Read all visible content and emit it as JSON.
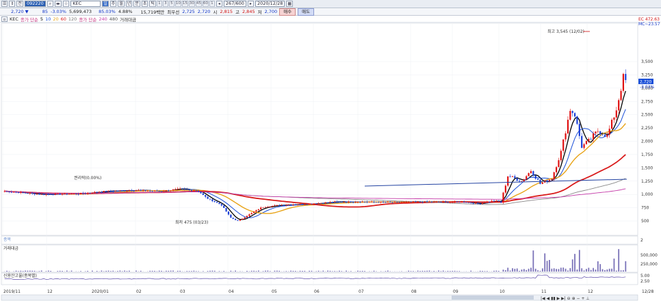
{
  "toolbar": {
    "code": "092220",
    "name": "KEC",
    "count": "267/600",
    "date": "2020/12/28",
    "periods": [
      "1",
      "3",
      "5",
      "10",
      "15",
      "30",
      "45",
      "60",
      "1"
    ],
    "daily_labels": [
      "주",
      "월",
      "년",
      "분",
      "초",
      "틱"
    ]
  },
  "quote": {
    "price": "2,720 ▼",
    "change": "85",
    "change_pct": "-3.03%",
    "volume": "5,699,473",
    "vol_ratio": "85.03%",
    "turnover": "4.88%",
    "amount": "15,719백만",
    "label_open": "최우선",
    "open": "2,725",
    "open2": "2,720",
    "label_high": "시",
    "high": "2,815",
    "label_hi": "고",
    "hi": "2,845",
    "label_lo": "저",
    "lo": "2,700",
    "buy": "매수",
    "sell": "매도"
  },
  "legend": {
    "name": "KEC",
    "ma_label": "종가 단순",
    "ma": [
      "5",
      "10",
      "20",
      "60",
      "120"
    ],
    "ma2_label": "종가 단순",
    "ma2": [
      "240",
      "480"
    ],
    "vol_label": "거래대금"
  },
  "price_axis": {
    "ticks": [
      "3,500",
      "3,250",
      "3,000",
      "2,750",
      "2,500",
      "2,250",
      "2,000",
      "1,750",
      "1,500",
      "1,250",
      "1,000",
      "750",
      "500"
    ],
    "top_label": "EC 472.63",
    "top_label2": "MC~23.57",
    "current": "2,720",
    "current_pct": "-3.03%"
  },
  "annotations": {
    "high": "최고 3,545 (12/02)",
    "low": "최저 475 (03/23)",
    "rights": "권리락(0.00%)"
  },
  "panels": {
    "p1": "종목",
    "p1_axis": "2",
    "vol": "거래대금",
    "vol_ticks": [
      "500,000",
      "250,000"
    ],
    "credit": "신용잔고율(종목별)",
    "credit_ticks": [
      "5.00",
      "2.50"
    ]
  },
  "date_axis": [
    "2019/11",
    "12",
    "2020/01",
    "02",
    "03",
    "04",
    "05",
    "06",
    "07",
    "08",
    "09",
    "10",
    "11",
    "12"
  ],
  "date_end": "12/28"
}
